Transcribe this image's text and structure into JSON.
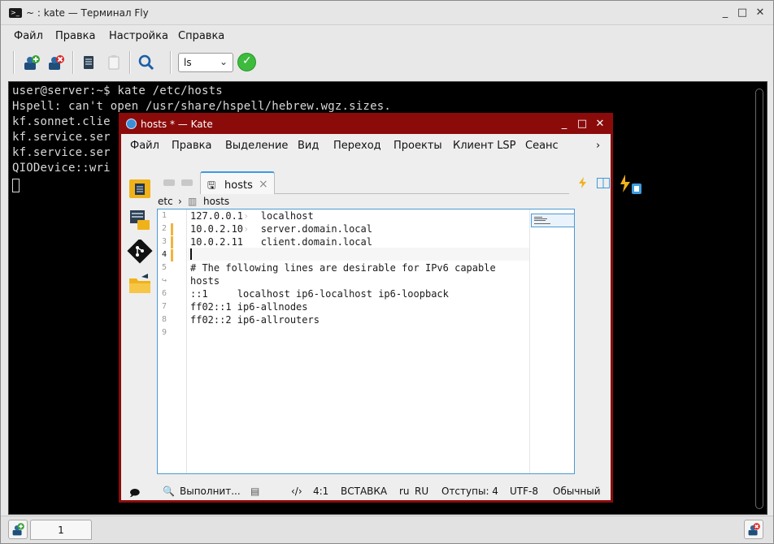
{
  "terminal": {
    "title": "~ : kate — Терминал Fly",
    "menu": [
      "Файл",
      "Правка",
      "Настройка",
      "Справка"
    ],
    "toolbar": {
      "command_value": "ls",
      "icons": [
        "new-session-icon",
        "close-session-icon",
        "copy-icon",
        "paste-icon",
        "find-icon",
        "run-icon"
      ]
    },
    "lines": [
      "user@server:~$ kate /etc/hosts",
      "Hspell: can't open /usr/share/hspell/hebrew.wgz.sizes.",
      "kf.sonnet.clie",
      "kf.service.ser",
      "kf.service.ser",
      "QIODevice::wri"
    ],
    "tab_label": "1",
    "colors": {
      "screen_bg": "#000000",
      "screen_fg": "#d8d8d8"
    }
  },
  "kate": {
    "title": "hosts * — Kate",
    "menu": [
      "Файл",
      "Правка",
      "Выделение",
      "Вид",
      "Переход",
      "Проекты",
      "Клиент LSP",
      "Сеанс"
    ],
    "menu_more": "›",
    "tab": {
      "name": "hosts",
      "close": "×"
    },
    "breadcrumb": {
      "dir": "etc",
      "sep": "›",
      "file": "hosts"
    },
    "gutter": [
      "1",
      "2",
      "3",
      "4",
      "5",
      "↪",
      "6",
      "7",
      "8",
      "9"
    ],
    "current_line": "4",
    "code": [
      {
        "a": "127.0.0.1",
        "tab": "›",
        "b": "  localhost"
      },
      {
        "a": "10.0.2.10",
        "tab": "›",
        "b": "  server.domain.local"
      },
      {
        "a": "10.0.2.11",
        "tab": "",
        "b": "   client.domain.local"
      },
      {
        "a": "",
        "tab": "",
        "b": ""
      },
      {
        "a": "# The following lines are desirable for IPv6 capable",
        "tab": "",
        "b": ""
      },
      {
        "a": "hosts",
        "tab": "",
        "b": ""
      },
      {
        "a": "::1     localhost ip6-localhost ip6-loopback",
        "tab": "",
        "b": ""
      },
      {
        "a": "ff02::1 ip6-allnodes",
        "tab": "",
        "b": ""
      },
      {
        "a": "ff02::2 ip6-allrouters",
        "tab": "",
        "b": ""
      }
    ],
    "status": {
      "search": "Выполнит...",
      "position": "4:1",
      "mode": "ВСТАВКА",
      "lang": "ru",
      "dict": "RU",
      "indent": "Отступы: 4",
      "encoding": "UTF-8",
      "highlight": "Обычный"
    },
    "colors": {
      "frame": "#8b0b0b",
      "accent": "#3d9be0",
      "modified_marker": "#f2b33d"
    }
  }
}
